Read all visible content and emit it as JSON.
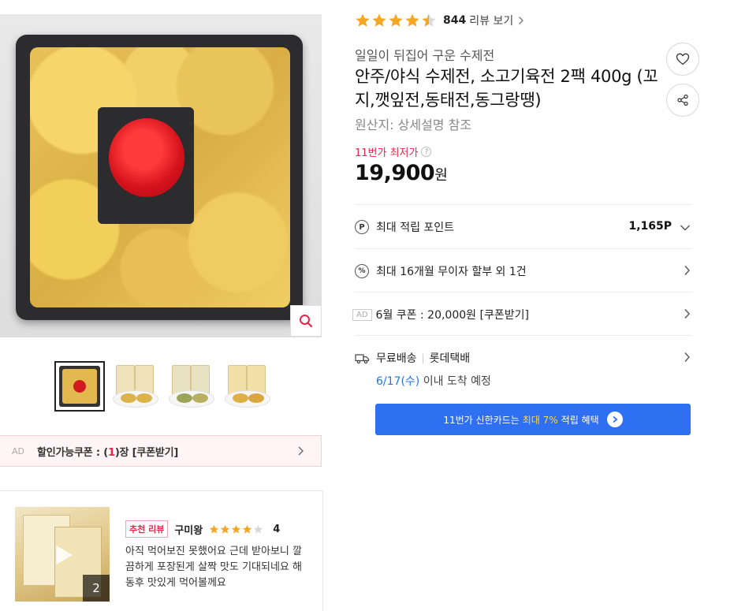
{
  "product": {
    "rating_value": 4.5,
    "review_count": "844",
    "review_link": "리뷰 보기",
    "seller": "일일이 뒤집어 구운 수제전",
    "title": "안주/야식 수제전, 소고기육전 2팩 400g (꼬지,깻잎전,동태전,동그랑땡)",
    "origin": "원산지:  상세설명 참조",
    "lowest_label": "11번가 최저가",
    "price": "19,900",
    "price_unit": "원"
  },
  "rows": {
    "points_label": "최대 적립 포인트",
    "points_value": "1,165P",
    "installment_label": "최대 16개월 무이자 할부 외 1건",
    "coupon_ad": "AD",
    "coupon_label": "6월 쿠폰 : 20,000원 [쿠폰받기]",
    "shipping_free": "무료배송",
    "shipping_carrier": "롯데택배",
    "arrival_date": "6/17(수)",
    "arrival_suffix": " 이내 도착 예정"
  },
  "card_banner": {
    "text": "11번가 신한카드는",
    "highlight": "최대 7%",
    "suffix": "적립 혜택"
  },
  "left": {
    "coupon_ad": "AD",
    "coupon_prefix": "할인가능쿠폰 : (",
    "coupon_count": "1",
    "coupon_suffix": ")장 [쿠폰받기]"
  },
  "review": {
    "badge": "추천 리뷰",
    "reviewer": "구미왕",
    "score": "4",
    "rating_value": 4,
    "text": "아직 먹어보진 못했어요 근데 받아보니 깔끔하게 포장된게 살짝 맛도 기대되네요 해동후 맛있게 먹어볼께요",
    "photo_count": "2"
  },
  "colors": {
    "star": "#f5a623",
    "accent_red": "#e8254a",
    "banner_blue": "#2f6ff2",
    "link_blue": "#1f77e8"
  },
  "icons": [
    "star-icon",
    "chevron-right-icon",
    "heart-icon",
    "share-icon",
    "point-icon",
    "percent-icon",
    "truck-icon",
    "zoom-icon",
    "play-icon",
    "chevron-down-icon"
  ]
}
